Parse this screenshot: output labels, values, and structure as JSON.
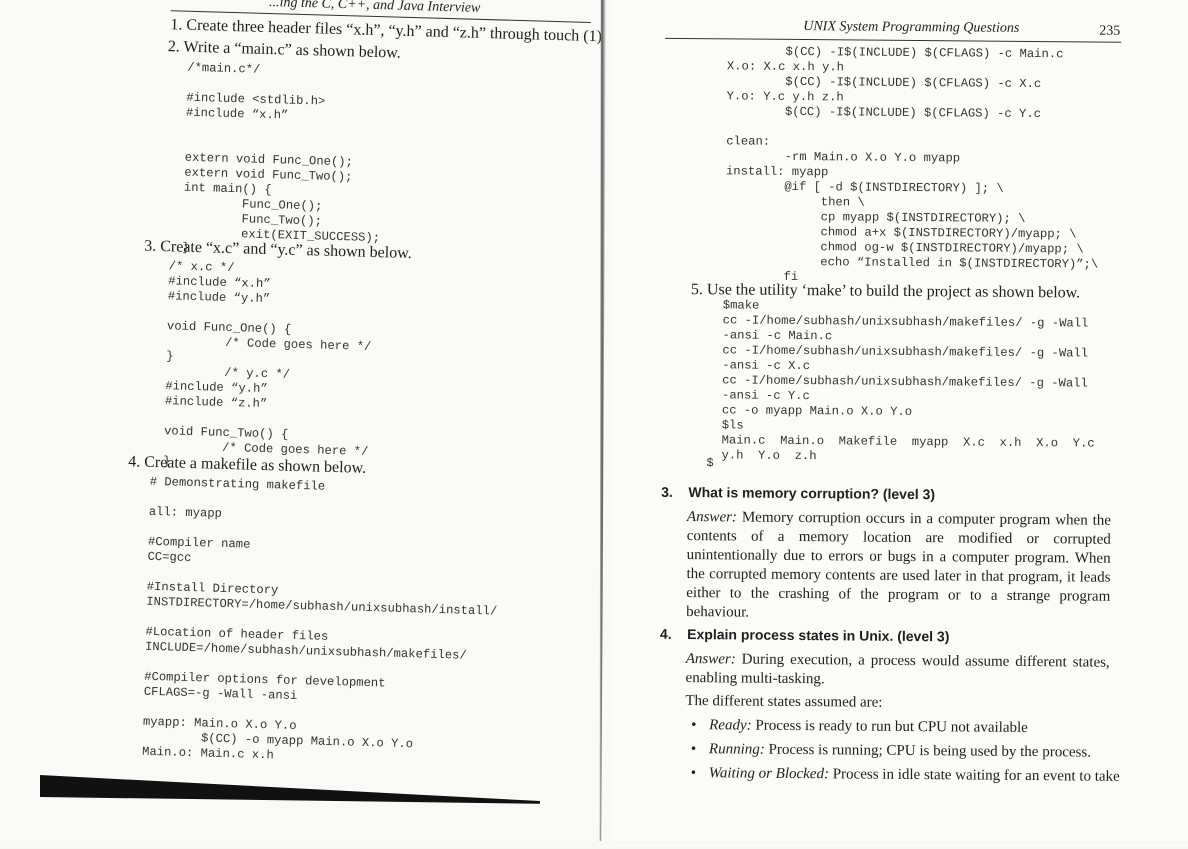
{
  "left_page": {
    "running_head": "...ing the C, C++, and Java Interview",
    "steps": [
      {
        "num": "1.",
        "text": "Create three header files “x.h”, “y.h” and “z.h” through touch (1)."
      },
      {
        "num": "2.",
        "text": "Write a “main.c” as shown below."
      },
      {
        "num": "3.",
        "text": "Create “x.c” and “y.c” as shown below."
      },
      {
        "num": "4.",
        "text": "Create a makefile as shown below."
      }
    ],
    "code_main": "/*main.c*/\n\n#include <stdlib.h>\n#include “x.h”\n\n\nextern void Func_One();\nextern void Func_Two();\nint main() {\n        Func_One();\n        Func_Two();\n        exit(EXIT_SUCCESS);\n}",
    "code_xy": "/* x.c */\n#include “x.h”\n#include “y.h”\n\nvoid Func_One() {\n        /* Code goes here */\n}\n        /* y.c */\n#include “y.h”\n#include “z.h”\n\nvoid Func_Two() {\n        /* Code goes here */\n}",
    "code_makefile": "# Demonstrating makefile\n\nall: myapp\n\n#Compiler name\nCC=gcc\n\n#Install Directory\nINSTDIRECTORY=/home/subhash/unixsubhash/install/\n\n#Location of header files\nINCLUDE=/home/subhash/unixsubhash/makefiles/\n\n#Compiler options for development\nCFLAGS=-g -Wall -ansi\n\nmyapp: Main.o X.o Y.o\n        $(CC) -o myapp Main.o X.o Y.o\nMain.o: Main.c x.h"
  },
  "right_page": {
    "running_head": "UNIX System Programming Questions",
    "page_number": "235",
    "code_makefile_cont": "        $(CC) -I$(INCLUDE) $(CFLAGS) -c Main.c\nX.o: X.c x.h y.h\n        $(CC) -I$(INCLUDE) $(CFLAGS) -c X.c\nY.o: Y.c y.h z.h\n        $(CC) -I$(INCLUDE) $(CFLAGS) -c Y.c\n\nclean:\n        -rm Main.o X.o Y.o myapp\ninstall: myapp\n        @if [ -d $(INSTDIRECTORY) ]; \\\n             then \\\n             cp myapp $(INSTDIRECTORY); \\\n             chmod a+x $(INSTDIRECTORY)/myapp; \\\n             chmod og-w $(INSTDIRECTORY)/myapp; \\\n             echo “Installed in $(INSTDIRECTORY)”;\\\n        fi",
    "step5": {
      "num": "5.",
      "text": "Use the utility ‘make’ to build the project as shown below."
    },
    "code_make_output": "$make\ncc -I/home/subhash/unixsubhash/makefiles/ -g -Wall\n-ansi -c Main.c\ncc -I/home/subhash/unixsubhash/makefiles/ -g -Wall\n-ansi -c X.c\ncc -I/home/subhash/unixsubhash/makefiles/ -g -Wall\n-ansi -c Y.c\ncc -o myapp Main.o X.o Y.o\n$ls\nMain.c  Main.o  Makefile  myapp  X.c  x.h  X.o  Y.c\ny.h  Y.o  z.h",
    "prompt": "$",
    "questions": [
      {
        "num": "3.",
        "title": "What is memory corruption? (level 3)",
        "answer_label": "Answer:",
        "answer": "Memory corruption occurs in a computer program when the contents of a memory location are modified or corrupted unintentionally due to errors or bugs in a computer program. When the corrupted memory contents are used later in that program, it leads either to the crashing of the program or to a strange program behaviour."
      },
      {
        "num": "4.",
        "title": "Explain process states in Unix. (level 3)",
        "answer_label": "Answer:",
        "answer": "During execution, a process would assume different states, enabling multi-tasking.",
        "states_intro": "The different states assumed are:",
        "states": [
          {
            "name": "Ready:",
            "desc": "Process is ready to run but CPU not available"
          },
          {
            "name": "Running:",
            "desc": "Process is running; CPU is being used by the process."
          },
          {
            "name": "Waiting or Blocked:",
            "desc": "Process in idle state waiting for an event to take"
          }
        ]
      }
    ]
  }
}
